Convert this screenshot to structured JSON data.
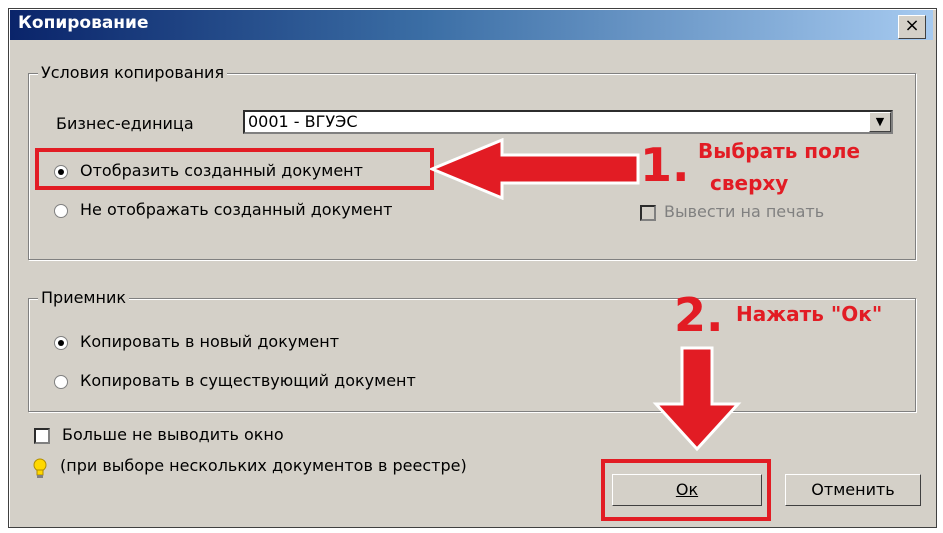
{
  "window": {
    "title": "Копирование",
    "close_glyph": "×"
  },
  "copy_conditions": {
    "legend": "Условия копирования",
    "business_unit_label": "Бизнес-единица",
    "business_unit_value": "0001 - ВГУЭС",
    "show_doc_label": "Отобразить созданный документ",
    "show_doc_selected": true,
    "hide_doc_label": "Не отображать созданный документ",
    "print_label": "Вывести на печать",
    "print_enabled": false
  },
  "receiver": {
    "legend": "Приемник",
    "new_doc_label": "Копировать в новый документ",
    "new_doc_selected": true,
    "existing_doc_label": "Копировать в существующий документ"
  },
  "footer": {
    "dont_show_label": "Больше не выводить окно",
    "hint": "(при выборе нескольких документов в реестре)",
    "ok_label": "Ок",
    "cancel_label": "Отменить"
  },
  "annotations": {
    "step1_number": "1.",
    "step1_text_line1": "Выбрать поле",
    "step1_text_line2": "сверху",
    "step2_number": "2.",
    "step2_text": "Нажать \"Ок\""
  },
  "colors": {
    "annotation_red": "#e21c24",
    "title_gradient_start": "#0a246a",
    "title_gradient_end": "#a6caf0",
    "dialog_bg": "#d4d0c8"
  },
  "icons": {
    "hint": "lightbulb-icon",
    "close": "close-icon",
    "dropdown": "chevron-down-icon"
  }
}
